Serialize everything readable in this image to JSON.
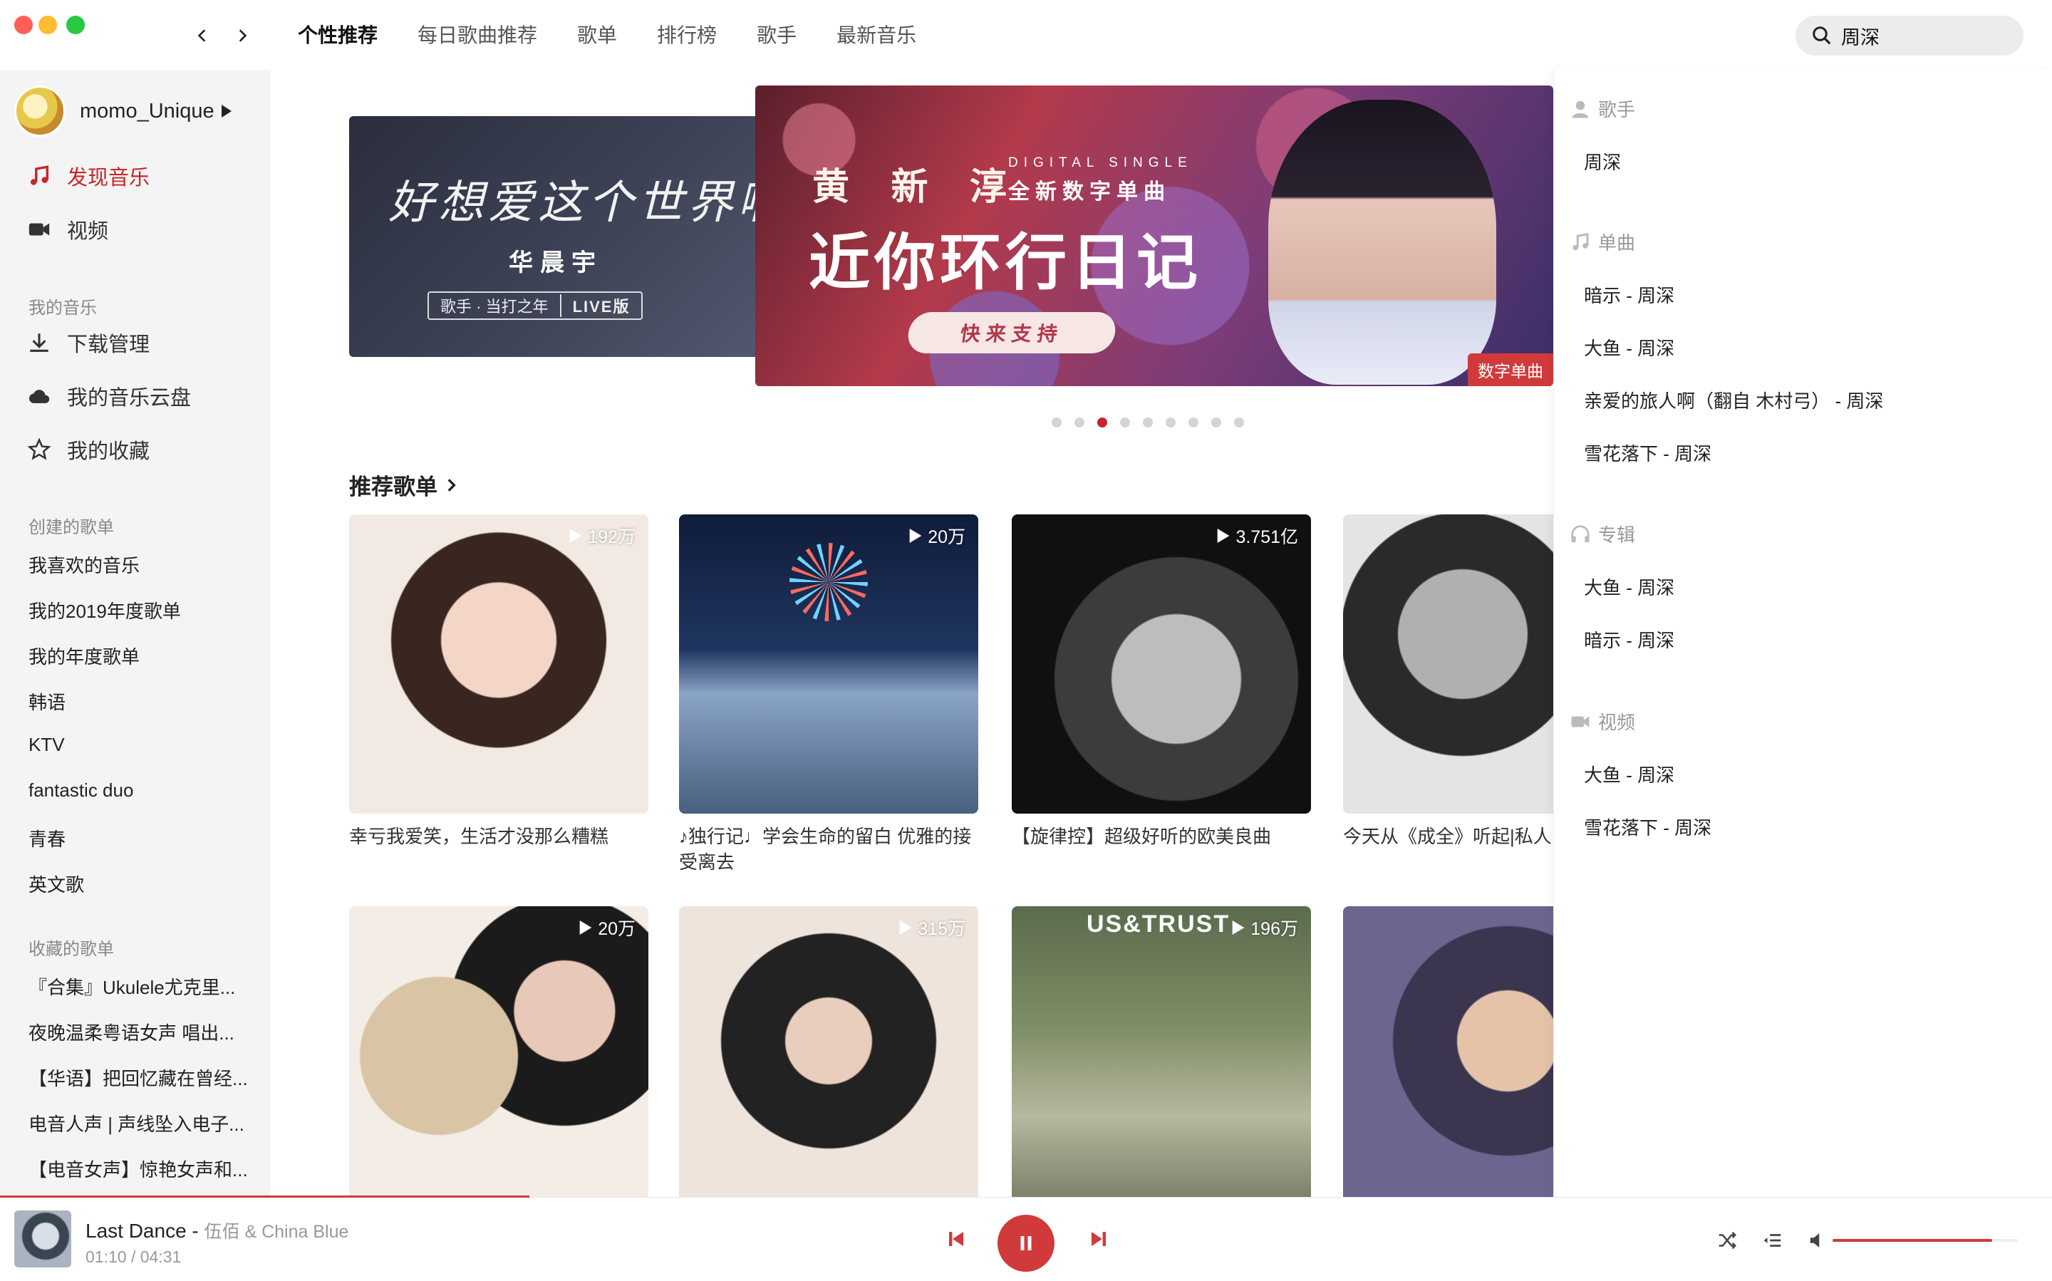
{
  "topbar": {
    "tabs": [
      {
        "label": "个性推荐",
        "active": true
      },
      {
        "label": "每日歌曲推荐",
        "active": false
      },
      {
        "label": "歌单",
        "active": false
      },
      {
        "label": "排行榜",
        "active": false
      },
      {
        "label": "歌手",
        "active": false
      },
      {
        "label": "最新音乐",
        "active": false
      }
    ],
    "search": {
      "value": "周深",
      "icon": "search-icon"
    }
  },
  "sidebar": {
    "user": {
      "name": "momo_Unique"
    },
    "main_items": [
      {
        "label": "发现音乐",
        "icon": "music-note-icon",
        "active": true
      },
      {
        "label": "视频",
        "icon": "video-camera-icon",
        "active": false
      }
    ],
    "my_music_title": "我的音乐",
    "my_music": [
      {
        "label": "下载管理",
        "icon": "download-icon"
      },
      {
        "label": "我的音乐云盘",
        "icon": "cloud-icon"
      },
      {
        "label": "我的收藏",
        "icon": "star-icon"
      }
    ],
    "created_title": "创建的歌单",
    "created": [
      "我喜欢的音乐",
      "我的2019年度歌单",
      "我的年度歌单",
      "韩语",
      "KTV",
      "fantastic duo",
      "青春",
      "英文歌"
    ],
    "collected_title": "收藏的歌单",
    "collected": [
      "『合集』Ukulele尤克里...",
      "夜晚温柔粤语女声 唱出...",
      "【华语】把回忆藏在曾经...",
      "电音人声 | 声线坠入电子...",
      "【电音女声】惊艳女声和..."
    ]
  },
  "banner": {
    "side": {
      "title": "好想爱这个世界啊",
      "artist": "华晨宇",
      "pill_left": "歌手 · 当打之年",
      "pill_right": "LIVE版"
    },
    "main": {
      "artist": "黄 新 淳",
      "sub_en": "DIGITAL SINGLE",
      "sub_cn": "全新数字单曲",
      "title": "近你环行日记",
      "cta": "快来支持",
      "tag": "数字单曲"
    },
    "dots_count": 9,
    "active_dot": 2
  },
  "recommend": {
    "title": "推荐歌单",
    "playlists": [
      {
        "plays": "192万",
        "title": "幸亏我爱笑，生活才没那么糟糕"
      },
      {
        "plays": "20万",
        "title": "♪独行记♩学会生命的留白 优雅的接受离去"
      },
      {
        "plays": "3.751亿",
        "title": "【旋律控】超级好听的欧美良曲"
      },
      {
        "plays": "",
        "title": "今天从《成全》听起|私人"
      },
      {
        "plays": "20万",
        "title": ""
      },
      {
        "plays": "315万",
        "title": ""
      },
      {
        "plays": "196万",
        "title": "",
        "cover_text": "US&TRUST"
      },
      {
        "plays": "",
        "title": ""
      }
    ]
  },
  "search_suggest": {
    "sections": [
      {
        "title": "歌手",
        "icon": "person-icon",
        "items": [
          "周深"
        ]
      },
      {
        "title": "单曲",
        "icon": "music-note-icon",
        "items": [
          "暗示 - 周深",
          "大鱼 - 周深",
          "亲爱的旅人啊（翻自 木村弓） - 周深",
          "雪花落下 - 周深"
        ]
      },
      {
        "title": "专辑",
        "icon": "headphones-icon",
        "items": [
          "大鱼 - 周深",
          "暗示 - 周深"
        ]
      },
      {
        "title": "视频",
        "icon": "video-camera-icon",
        "items": [
          "大鱼 - 周深",
          "雪花落下 - 周深"
        ]
      }
    ]
  },
  "player": {
    "title": "Last Dance",
    "separator": " - ",
    "artist": "伍佰 & China Blue",
    "time": "01:10 / 04:31",
    "progress": 0.258,
    "volume": 0.86,
    "accent": "#d13a3a"
  }
}
